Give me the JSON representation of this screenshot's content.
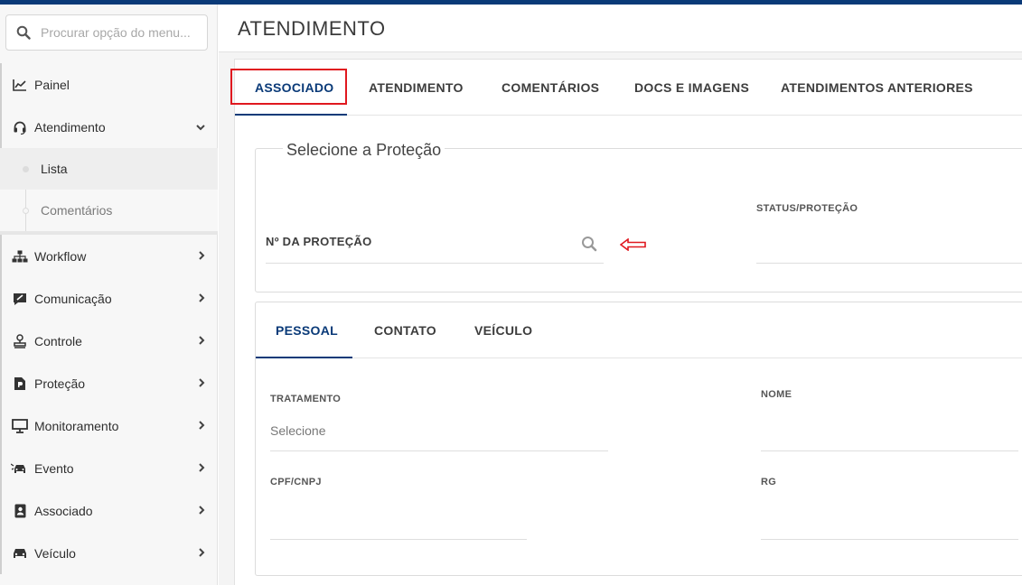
{
  "search": {
    "placeholder": "Procurar opção do menu..."
  },
  "sidebar": {
    "items": [
      {
        "label": "Painel",
        "icon": "chart-line-icon",
        "has_chevron": false
      },
      {
        "label": "Atendimento",
        "icon": "headset-icon",
        "expanded": true,
        "subitems": [
          {
            "label": "Lista",
            "active": true
          },
          {
            "label": "Comentários",
            "active": false
          }
        ]
      },
      {
        "label": "Workflow",
        "icon": "sitemap-icon"
      },
      {
        "label": "Comunicação",
        "icon": "comment-edit-icon"
      },
      {
        "label": "Controle",
        "icon": "stamp-icon"
      },
      {
        "label": "Proteção",
        "icon": "file-document-icon"
      },
      {
        "label": "Monitoramento",
        "icon": "desktop-icon"
      },
      {
        "label": "Evento",
        "icon": "car-crash-icon"
      },
      {
        "label": "Associado",
        "icon": "id-badge-icon"
      },
      {
        "label": "Veículo",
        "icon": "car-icon"
      }
    ]
  },
  "header": {
    "title": "ATENDIMENTO"
  },
  "tabs": [
    {
      "label": "ASSOCIADO",
      "active": true
    },
    {
      "label": "ATENDIMENTO",
      "active": false
    },
    {
      "label": "COMENTÁRIOS",
      "active": false
    },
    {
      "label": "DOCS E IMAGENS",
      "active": false
    },
    {
      "label": "ATENDIMENTOS ANTERIORES",
      "active": false
    }
  ],
  "protection": {
    "legend": "Selecione a Proteção",
    "number_label": "Nº DA PROTEÇÃO",
    "status_label": "STATUS/PROTEÇÃO"
  },
  "subtabs": [
    {
      "label": "PESSOAL",
      "active": true
    },
    {
      "label": "CONTATO",
      "active": false
    },
    {
      "label": "VEÍCULO",
      "active": false
    }
  ],
  "personal": {
    "tratamento_label": "TRATAMENTO",
    "tratamento_value": "Selecione",
    "nome_label": "NOME",
    "cpf_label": "CPF/CNPJ",
    "rg_label": "RG"
  },
  "colors": {
    "accent": "#0a3a78",
    "highlight": "#e0181f"
  }
}
